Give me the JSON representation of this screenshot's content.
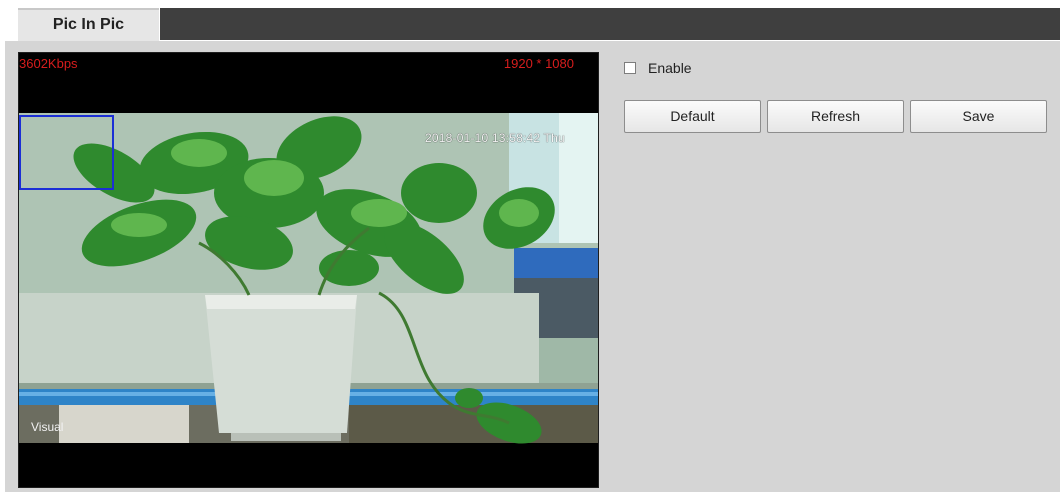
{
  "tabs": [
    {
      "label": "Pic In Pic",
      "active": true
    }
  ],
  "video": {
    "bitrate": "3602Kbps",
    "resolution": "1920 * 1080",
    "timestamp": "2018-01-10 13:58:42 Thu",
    "channel_label": "Visual",
    "osd_color": "#d71d1d",
    "roi_color": "#1c2fd6"
  },
  "controls": {
    "enable_label": "Enable",
    "enable_checked": false,
    "default_label": "Default",
    "refresh_label": "Refresh",
    "save_label": "Save"
  }
}
